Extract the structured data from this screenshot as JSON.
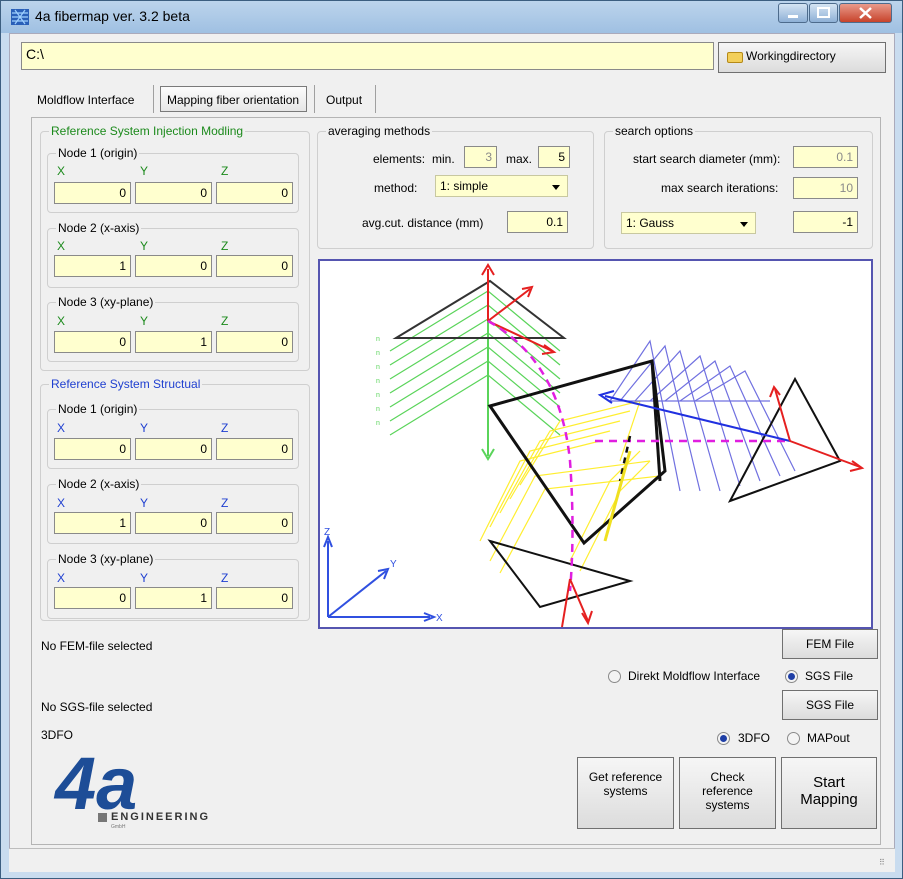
{
  "window": {
    "title": "4a fibermap ver. 3.2 beta"
  },
  "path": {
    "value": "C:\\"
  },
  "workingdir": {
    "label": "Workingdirectory"
  },
  "tabs": [
    {
      "label": "Moldflow Interface"
    },
    {
      "label": "Mapping fiber orientation"
    },
    {
      "label": "Output"
    }
  ],
  "ref_im": {
    "title": "Reference System Injection Modling",
    "nodes": [
      {
        "label": "Node 1 (origin)",
        "x": "0",
        "y": "0",
        "z": "0"
      },
      {
        "label": "Node 2 (x-axis)",
        "x": "1",
        "y": "0",
        "z": "0"
      },
      {
        "label": "Node 3 (xy-plane)",
        "x": "0",
        "y": "1",
        "z": "0"
      }
    ]
  },
  "ref_st": {
    "title": "Reference System Structual",
    "nodes": [
      {
        "label": "Node 1 (origin)",
        "x": "0",
        "y": "0",
        "z": "0"
      },
      {
        "label": "Node 2 (x-axis)",
        "x": "1",
        "y": "0",
        "z": "0"
      },
      {
        "label": "Node 3 (xy-plane)",
        "x": "0",
        "y": "1",
        "z": "0"
      }
    ]
  },
  "axis_labels": {
    "x": "X",
    "y": "Y",
    "z": "Z"
  },
  "averaging": {
    "title": "averaging methods",
    "elements_label": "elements:",
    "min_label": "min.",
    "min": "3",
    "max_label": "max.",
    "max": "5",
    "method_label": "method:",
    "method_value": "1: simple",
    "cut_label": "avg.cut. distance (mm)",
    "cut_value": "0.1"
  },
  "search": {
    "title": "search options",
    "diam_label": "start search diameter (mm):",
    "diam_value": "0.1",
    "iter_label": "max search iterations:",
    "iter_value": "10",
    "kernel_value": "1: Gauss",
    "kernel_param": "-1"
  },
  "files": {
    "fem_status": "No FEM-file selected",
    "fem_button": "FEM File",
    "radio_direct": "Direkt Moldflow Interface",
    "radio_sgs": "SGS File",
    "sgs_status": "No SGS-file selected",
    "sgs_button": "SGS File",
    "format_label": "3DFO",
    "radio_3dfo": "3DFO",
    "radio_mapout": "MAPout"
  },
  "actions": {
    "get_ref": "Get reference systems",
    "check_ref": "Check reference systems",
    "start": "Start Mapping"
  },
  "logo": {
    "text": "4a",
    "subtitle": "ENGINEERING",
    "small": "GmbH"
  },
  "colors": {
    "green": "#1c8a1c",
    "blue": "#1f3fd0",
    "field_bg": "#ffffcf"
  }
}
